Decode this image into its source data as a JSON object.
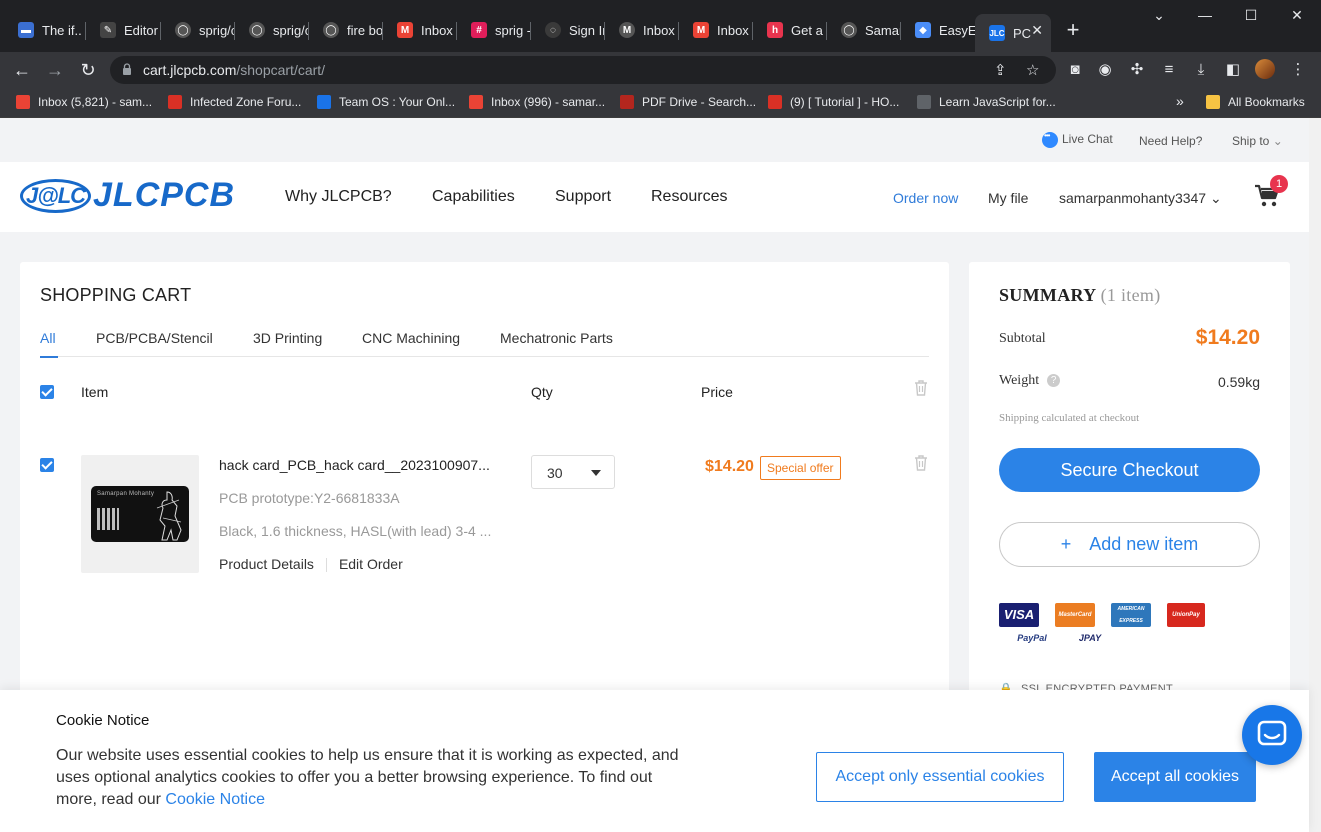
{
  "browser": {
    "tabs": [
      {
        "title": "The if..",
        "color": "#5f6368"
      },
      {
        "title": "Editor",
        "color": "#5f6368"
      },
      {
        "title": "sprig/c",
        "color": "#5f6368"
      },
      {
        "title": "sprig/c",
        "color": "#5f6368"
      },
      {
        "title": "fire bo",
        "color": "#5f6368"
      },
      {
        "title": "Inbox",
        "color": "#ea4335"
      },
      {
        "title": "sprig -",
        "color": "#e01e5a"
      },
      {
        "title": "Sign Ir",
        "color": "#5f6368"
      },
      {
        "title": "Inbox",
        "color": "#ea4335"
      },
      {
        "title": "Inbox",
        "color": "#ea4335"
      },
      {
        "title": "Get a",
        "color": "#e8344e"
      },
      {
        "title": "Samar",
        "color": "#5f6368"
      },
      {
        "title": "EasyEI",
        "color": "#4a8df8"
      },
      {
        "title": "PC",
        "color": "#1a73e8"
      }
    ],
    "url_host": "cart.jlcpcb.com",
    "url_path": "/shopcart/cart/",
    "bookmarks": [
      {
        "label": "Inbox (5,821) - sam...",
        "color": "#ea4335"
      },
      {
        "label": "Infected Zone Foru...",
        "color": "#d93025"
      },
      {
        "label": "Team OS : Your Onl...",
        "color": "#1a73e8"
      },
      {
        "label": "Inbox (996) - samar...",
        "color": "#ea4335"
      },
      {
        "label": "PDF Drive - Search...",
        "color": "#b3261e"
      },
      {
        "label": "(9) [ Tutorial ] - HO...",
        "color": "#d93025"
      },
      {
        "label": "Learn JavaScript for...",
        "color": "#5f6368"
      }
    ],
    "more_label": "»",
    "all_bookmarks": "All Bookmarks"
  },
  "topbar": {
    "live_chat": "Live Chat",
    "need_help": "Need Help?",
    "ship_to": "Ship to"
  },
  "header": {
    "logo_badge": "J@LC",
    "logo_word": "JLCPCB",
    "nav": [
      "Why JLCPCB?",
      "Capabilities",
      "Support",
      "Resources"
    ],
    "order_now": "Order now",
    "my_file": "My file",
    "username": "samarpanmohanty3347",
    "cart_count": "1"
  },
  "cart": {
    "title": "SHOPPING CART",
    "tabs": [
      "All",
      "PCB/PCBA/Stencil",
      "3D Printing",
      "CNC Machining",
      "Mechatronic Parts"
    ],
    "columns": {
      "item": "Item",
      "qty": "Qty",
      "price": "Price"
    },
    "item": {
      "name": "hack card_PCB_hack card__2023100907...",
      "prototype": "PCB prototype:Y2-6681833A",
      "specs": "Black, 1.6 thickness, HASL(with lead) 3-4 ...",
      "product_details": "Product Details",
      "edit_order": "Edit Order",
      "qty": "30",
      "price": "$14.20",
      "badge": "Special offer",
      "thumb_text": "Samarpan Mohanty"
    }
  },
  "summary": {
    "title": "SUMMARY",
    "count": "(1 item)",
    "subtotal_label": "Subtotal",
    "subtotal": "$14.20",
    "weight_label": "Weight",
    "weight": "0.59kg",
    "shipping_note": "Shipping calculated at checkout",
    "checkout": "Secure Checkout",
    "add_item": "Add new item",
    "payments": [
      "VISA",
      "MasterCard",
      "AMERICAN EXPRESS",
      "UnionPay",
      "PayPal",
      "JPAY"
    ],
    "ssl": "SSL ENCRYPTED PAYMENT"
  },
  "cookie": {
    "title": "Cookie Notice",
    "body": "Our website uses essential cookies to help us ensure that it is working as expected, and uses optional analytics cookies to offer you a better browsing experience. To find out more, read our ",
    "link": "Cookie Notice",
    "btn_essential": "Accept only essential cookies",
    "btn_all": "Accept all cookies"
  }
}
